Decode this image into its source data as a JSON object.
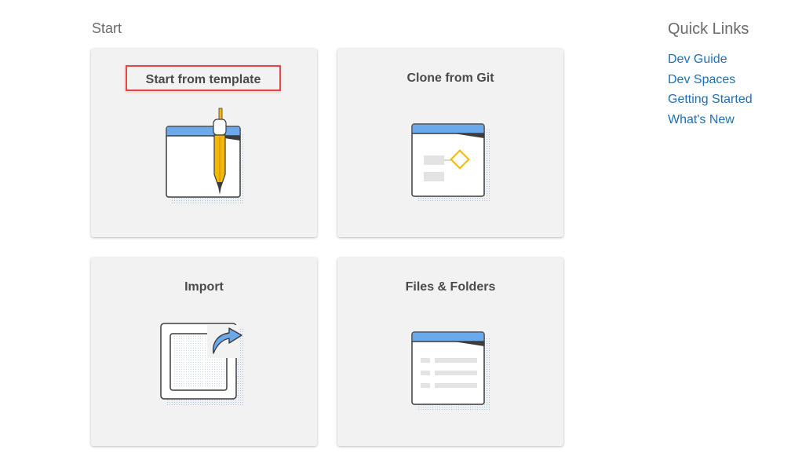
{
  "start": {
    "title": "Start",
    "cards": [
      {
        "label": "Start from template",
        "icon": "template-pen-icon"
      },
      {
        "label": "Clone from Git",
        "icon": "git-diagram-icon"
      },
      {
        "label": "Import",
        "icon": "import-arrow-icon"
      },
      {
        "label": "Files & Folders",
        "icon": "files-list-icon"
      }
    ]
  },
  "quick_links": {
    "title": "Quick Links",
    "items": [
      {
        "label": "Dev Guide"
      },
      {
        "label": "Dev Spaces"
      },
      {
        "label": "Getting Started"
      },
      {
        "label": "What's New"
      }
    ]
  },
  "colors": {
    "accent_blue": "#6aa9ec",
    "link": "#1f6fb5",
    "pen_yellow": "#f5b800",
    "highlight_red": "#e04848",
    "card_bg": "#f2f2f2"
  }
}
